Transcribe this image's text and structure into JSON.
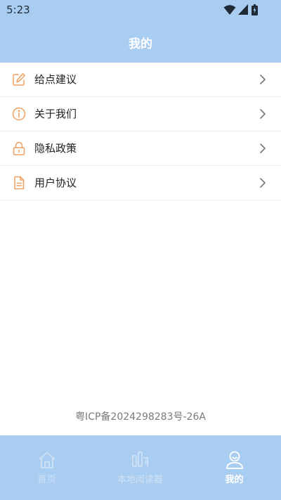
{
  "status": {
    "time": "5:23"
  },
  "header": {
    "title": "我的"
  },
  "menu": {
    "items": [
      {
        "label": "给点建议",
        "icon": "edit-icon"
      },
      {
        "label": "关于我们",
        "icon": "info-icon"
      },
      {
        "label": "隐私政策",
        "icon": "lock-icon"
      },
      {
        "label": "用户协议",
        "icon": "document-icon"
      }
    ]
  },
  "footer": {
    "icp": "粤ICP备2024298283号-26A"
  },
  "tabs": [
    {
      "label": "首页",
      "icon": "home-icon",
      "active": false
    },
    {
      "label": "本地阅读器",
      "icon": "reader-icon",
      "active": false
    },
    {
      "label": "我的",
      "icon": "profile-icon",
      "active": true
    }
  ],
  "colors": {
    "header_bg": "#a9cdf0",
    "accent_orange": "#f0a060",
    "tab_inactive": "#cfe2f5",
    "tab_active": "#ffffff"
  }
}
